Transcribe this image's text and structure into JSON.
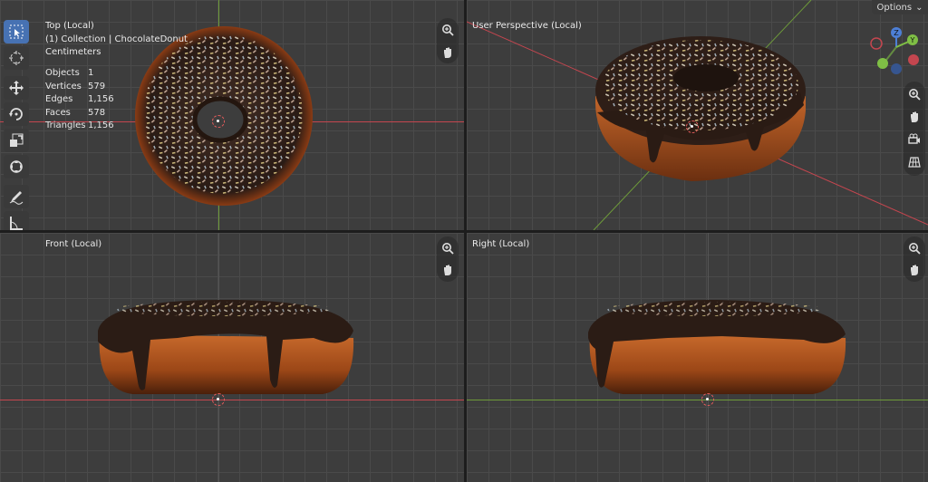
{
  "header": {
    "options_label": "Options",
    "options_chevron": "⌄"
  },
  "viewports": {
    "top": {
      "title": "Top (Local)",
      "collection": "(1) Collection | ChocolateDonut",
      "units": "Centimeters"
    },
    "perspective": {
      "title": "User Perspective (Local)"
    },
    "front": {
      "title": "Front (Local)"
    },
    "right": {
      "title": "Right (Local)"
    }
  },
  "stats": [
    {
      "label": "Objects",
      "value": "1"
    },
    {
      "label": "Vertices",
      "value": "579"
    },
    {
      "label": "Edges",
      "value": "1,156"
    },
    {
      "label": "Faces",
      "value": "578"
    },
    {
      "label": "Triangles",
      "value": "1,156"
    }
  ],
  "gizmo": {
    "z": "Z",
    "y": "Y"
  },
  "toolbar": {
    "tools": [
      "select-box-icon",
      "cursor-icon",
      "move-icon",
      "rotate-icon",
      "scale-icon",
      "transform-icon",
      "annotate-icon",
      "measure-icon",
      "add-cube-icon",
      "extrude-icon"
    ]
  },
  "colors": {
    "viewport_bg": "#3d3d3d",
    "grid": "#4a4a4a",
    "x_axis": "#c4464f",
    "y_axis": "#6e9b3a",
    "active_tool": "#4772b3",
    "chocolate": "#2d1d16",
    "dough": "#9b4a17"
  }
}
